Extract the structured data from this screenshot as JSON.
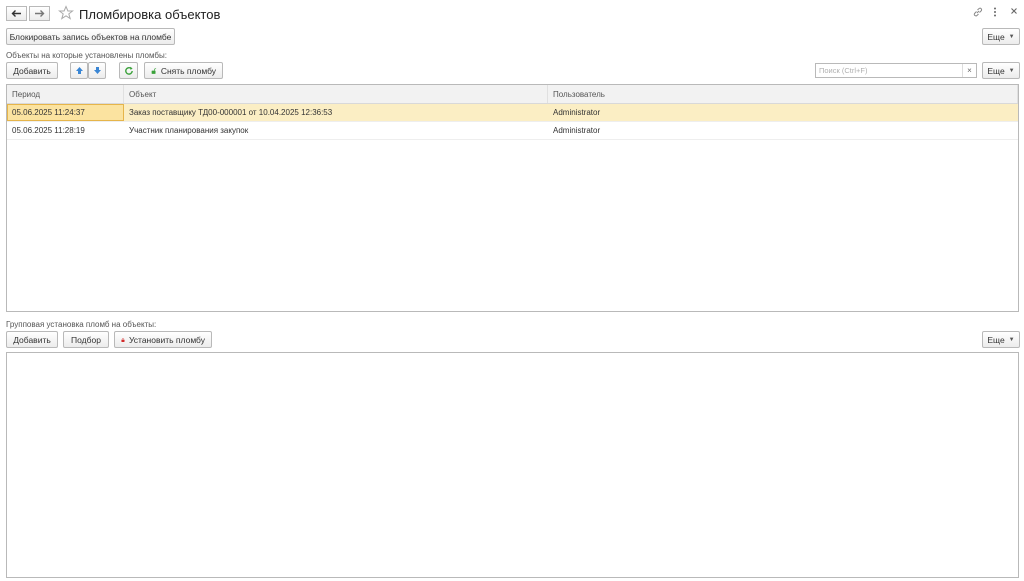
{
  "window": {
    "title": "Пломбировка объектов"
  },
  "toolbar_top": {
    "block_record_label": "Блокировать запись объектов на пломбе",
    "more_label": "Еще"
  },
  "sealed_section": {
    "caption": "Объекты на которые установлены пломбы:",
    "add_label": "Добавить",
    "remove_seal_label": "Снять пломбу",
    "search_placeholder": "Поиск (Ctrl+F)",
    "more_label": "Еще",
    "columns": [
      "Период",
      "Объект",
      "Пользователь"
    ],
    "rows": [
      {
        "period": "05.06.2025 11:24:37",
        "object": "Заказ поставщику ТД00-000001 от 10.04.2025 12:36:53",
        "user": "Administrator"
      },
      {
        "period": "05.06.2025 11:28:19",
        "object": "Участник планирования закупок",
        "user": "Administrator"
      }
    ]
  },
  "group_section": {
    "caption": "Групповая установка пломб на объекты:",
    "add_label": "Добавить",
    "pick_label": "Подбор",
    "set_seal_label": "Установить пломбу",
    "more_label": "Еще"
  },
  "colors": {
    "selected_row": "#fbeec4",
    "accent_blue": "#3a86d4",
    "refresh_green": "#3aa13a",
    "lock_red": "#d22a2a"
  }
}
